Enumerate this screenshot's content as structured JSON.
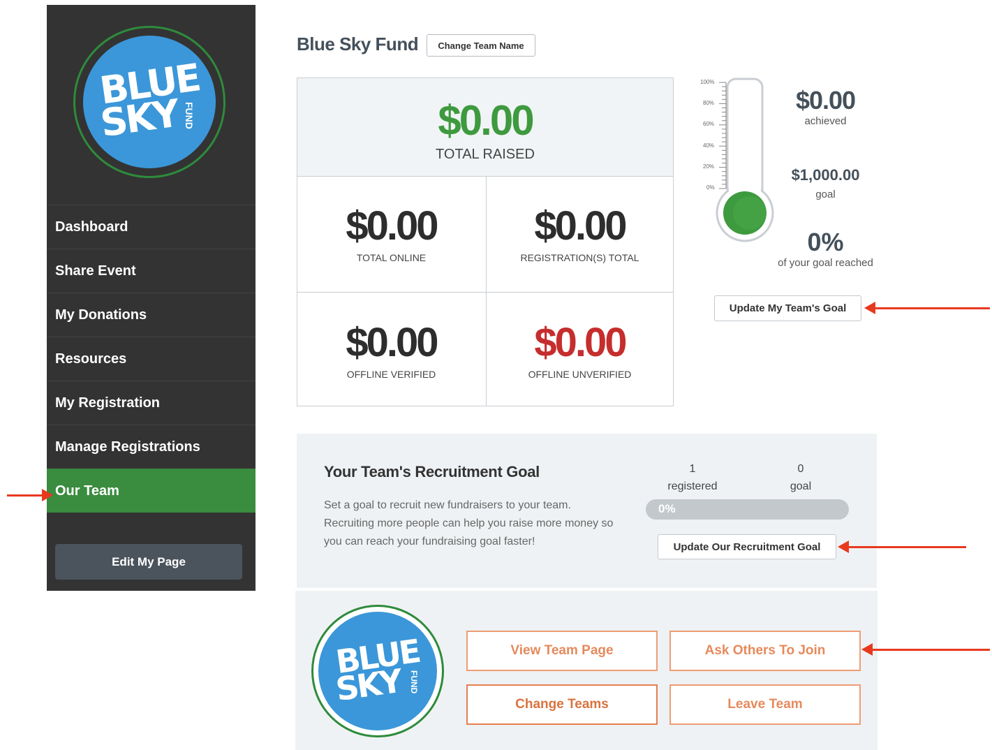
{
  "sidebar": {
    "logo": {
      "line1": "BLUE",
      "line2": "SKY",
      "side": "FUND"
    },
    "items": [
      {
        "label": "Dashboard"
      },
      {
        "label": "Share Event"
      },
      {
        "label": "My Donations"
      },
      {
        "label": "Resources"
      },
      {
        "label": "My Registration"
      },
      {
        "label": "Manage Registrations"
      },
      {
        "label": "Our Team",
        "active": true
      }
    ],
    "edit_button": "Edit My Page"
  },
  "header": {
    "team_name": "Blue Sky Fund",
    "change_name_button": "Change Team Name"
  },
  "stats": {
    "total_raised": {
      "value": "$0.00",
      "label": "TOTAL RAISED"
    },
    "total_online": {
      "value": "$0.00",
      "label": "TOTAL ONLINE"
    },
    "registration_total": {
      "value": "$0.00",
      "label": "REGISTRATION(S) TOTAL"
    },
    "offline_verified": {
      "value": "$0.00",
      "label": "OFFLINE VERIFIED"
    },
    "offline_unverified": {
      "value": "$0.00",
      "label": "OFFLINE UNVERIFIED"
    }
  },
  "thermometer": {
    "ticks": [
      "100%",
      "80%",
      "60%",
      "40%",
      "20%",
      "0%"
    ],
    "fill_fraction": 0,
    "achieved_value": "$0.00",
    "achieved_label": "achieved",
    "goal_value": "$1,000.00",
    "goal_label": "goal",
    "percent_value": "0%",
    "percent_label": "of your goal reached",
    "update_button": "Update My Team's Goal"
  },
  "recruitment": {
    "title": "Your Team's Recruitment Goal",
    "description": "Set a goal to recruit new fundraisers to your team. Recruiting more people can help you raise more money so you can reach your fundraising goal faster!",
    "registered_count": "1",
    "registered_label": "registered",
    "goal_count": "0",
    "goal_label": "goal",
    "progress_text": "0%",
    "progress_fraction": 0,
    "update_button": "Update Our Recruitment Goal"
  },
  "team_actions": {
    "view_team_page": "View Team Page",
    "ask_others": "Ask Others To Join",
    "change_teams": "Change Teams",
    "leave_team": "Leave Team"
  },
  "colors": {
    "sidebar_bg": "#333333",
    "active_nav": "#3a8c3f",
    "raised_green": "#3e9a3f",
    "unverified_red": "#c62d2d",
    "action_orange": "#ee9c74",
    "logo_blue": "#3b97d9",
    "annotation_arrow": "#e8391f"
  }
}
